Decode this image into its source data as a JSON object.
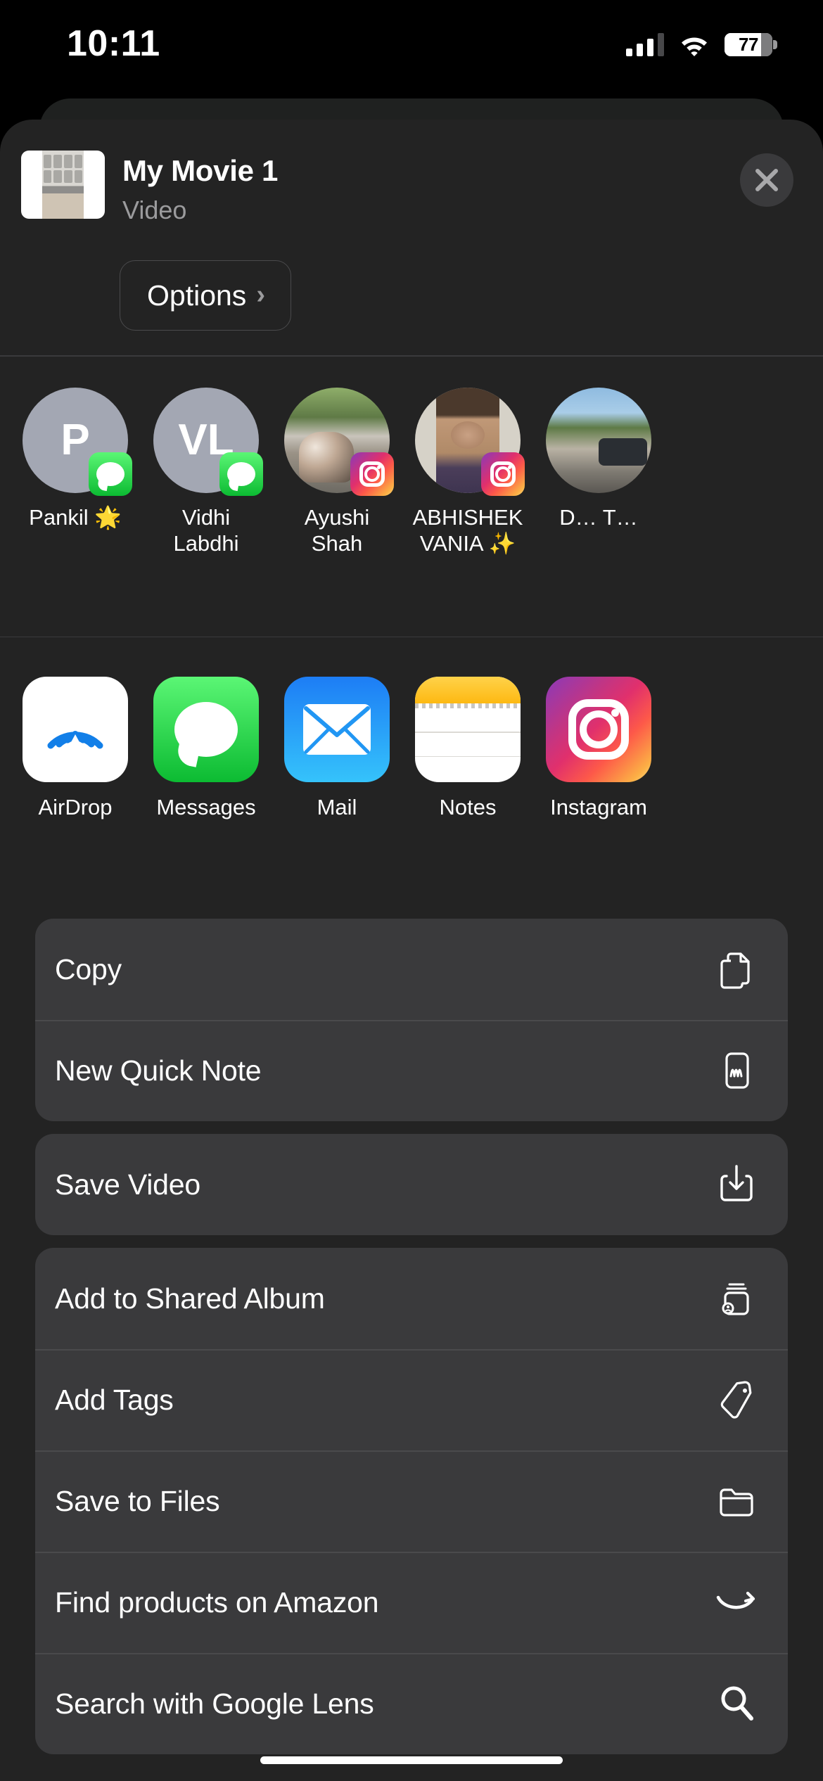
{
  "status_bar": {
    "time": "10:11",
    "signal_icon": "cellular-signal-icon",
    "signal_bars_filled": 3,
    "signal_bars_total": 4,
    "wifi_icon": "wifi-icon",
    "battery_icon": "battery-icon",
    "battery_percent": "77",
    "battery_level": 77
  },
  "header": {
    "thumbnail_name": "video-thumbnail",
    "title": "My Movie 1",
    "subtitle": "Video",
    "close_label": "close-icon",
    "options_label": "Options",
    "options_chevron": "›"
  },
  "contacts": {
    "items": [
      {
        "name": "Pankil 🌟",
        "initials": "P",
        "avatar_type": "initials",
        "badge": "messages-badge"
      },
      {
        "name": "Vidhi Labdhi",
        "initials": "VL",
        "avatar_type": "initials",
        "badge": "messages-badge"
      },
      {
        "name": "Ayushi Shah",
        "initials": "",
        "avatar_type": "photo",
        "badge": "instagram-badge"
      },
      {
        "name": "ABHISHEK VANIA ✨",
        "initials": "",
        "avatar_type": "photo",
        "badge": "instagram-badge"
      },
      {
        "name": "D… T…",
        "initials": "",
        "avatar_type": "photo",
        "badge": ""
      }
    ]
  },
  "apps": {
    "items": [
      {
        "label": "AirDrop",
        "icon": "airdrop-icon"
      },
      {
        "label": "Messages",
        "icon": "messages-icon"
      },
      {
        "label": "Mail",
        "icon": "mail-icon"
      },
      {
        "label": "Notes",
        "icon": "notes-icon"
      },
      {
        "label": "Instagram",
        "icon": "instagram-icon"
      }
    ]
  },
  "action_groups": [
    {
      "rows": [
        {
          "label": "Copy",
          "icon": "copy-documents-icon"
        },
        {
          "label": "New Quick Note",
          "icon": "quick-note-icon"
        }
      ]
    },
    {
      "rows": [
        {
          "label": "Save Video",
          "icon": "save-download-icon"
        }
      ]
    },
    {
      "rows": [
        {
          "label": "Add to Shared Album",
          "icon": "shared-album-icon"
        },
        {
          "label": "Add Tags",
          "icon": "tag-icon"
        },
        {
          "label": "Save to Files",
          "icon": "folder-icon"
        },
        {
          "label": "Find products on Amazon",
          "icon": "amazon-smile-icon"
        },
        {
          "label": "Search with Google Lens",
          "icon": "magnifying-glass-icon"
        }
      ]
    }
  ],
  "colors": {
    "sheet_background": "#232323",
    "card_background": "#3a3a3c",
    "divider": "#4a4a4c",
    "text_primary": "#ffffff",
    "text_secondary": "#9b9b9d",
    "messages_green": "#0cbb32",
    "mail_blue": "#1d7df5",
    "notes_yellow": "#fdb912",
    "airdrop_blue": "#1d7df5"
  }
}
